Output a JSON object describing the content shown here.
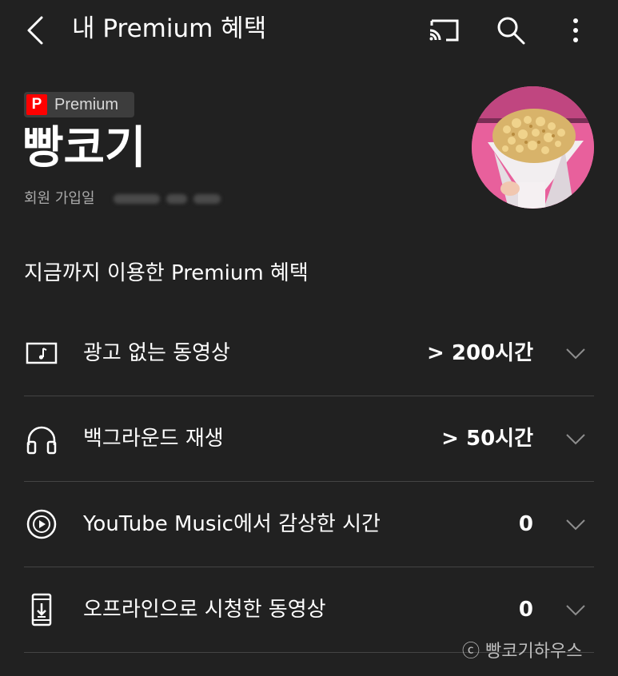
{
  "header": {
    "title": "내 Premium 혜택",
    "icons": [
      "back-arrow-icon",
      "cast-icon",
      "search-icon",
      "more-vert-icon"
    ]
  },
  "profile": {
    "badge_letter": "P",
    "badge_label": "Premium",
    "name": "빵코기",
    "join_label": "회원 가입일"
  },
  "section_title": "지금까지 이용한 Premium 혜택",
  "benefits": [
    {
      "icon": "ad-free-video-icon",
      "label": "광고 없는 동영상",
      "value": "> 200시간"
    },
    {
      "icon": "headphones-icon",
      "label": "백그라운드 재생",
      "value": "> 50시간"
    },
    {
      "icon": "youtube-music-icon",
      "label": "YouTube Music에서 감상한 시간",
      "value": "0"
    },
    {
      "icon": "offline-download-icon",
      "label": "오프라인으로 시청한 동영상",
      "value": "0"
    }
  ],
  "watermark": "ⓒ 빵코기하우스",
  "colors": {
    "background": "#212121",
    "text": "#ffffff",
    "muted": "#aaaaaa",
    "divider": "#444444",
    "premium_red": "#ff0000"
  }
}
